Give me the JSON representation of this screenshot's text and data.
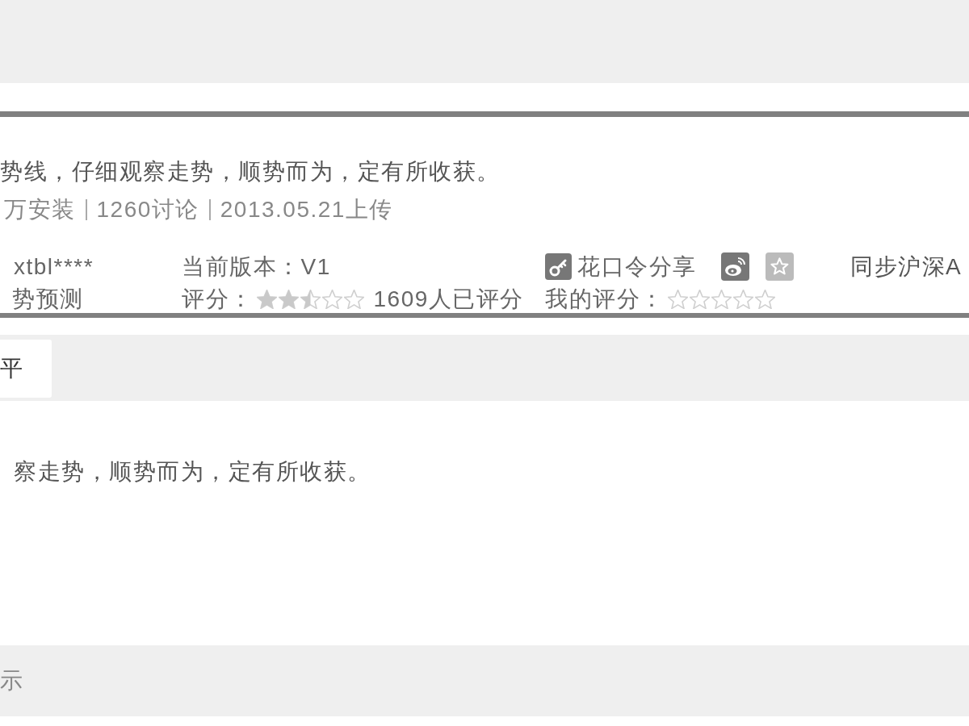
{
  "app": {
    "description": "势线，仔细观察走势，顺势而为，定有所收获。",
    "stats": [
      "万安装",
      "1260讨论",
      "2013.05.21上传"
    ],
    "author": "xtbl****",
    "category": "势预测",
    "version": "当前版本：V1",
    "share_label": "花口令分享",
    "sync_label": "同步沪深A",
    "rating": {
      "label": "评分：",
      "stars": 2.5,
      "count": "1609人已评分"
    },
    "my_rating": {
      "label": "我的评分：",
      "stars": 0
    }
  },
  "tabs": [
    {
      "label": "平",
      "selected": true
    }
  ],
  "body_text": "察走势，顺势而为，定有所收获。",
  "notice": {
    "title": "示"
  }
}
